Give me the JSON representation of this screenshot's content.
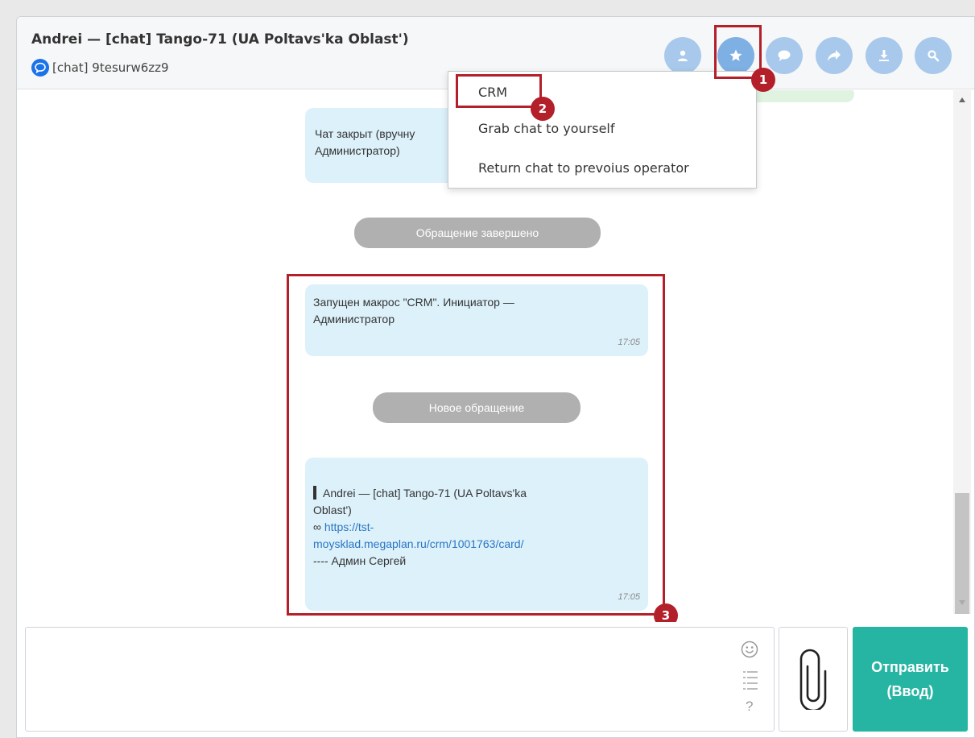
{
  "header": {
    "title": "Andrei — [chat] Tango-71 (UA Poltavs'ka Oblast')",
    "subtitle": "[chat] 9tesurw6zz9",
    "buttons": [
      "user-icon",
      "star-icon",
      "chat-icon",
      "forward-icon",
      "download-icon",
      "search-icon"
    ]
  },
  "dropdown": {
    "items": [
      "CRM",
      "Grab chat to yourself",
      "Return chat to prevoius operator"
    ]
  },
  "messages": {
    "closed_text_line1": "Чат закрыт (вручну",
    "closed_text_line2": "Администратор)",
    "pill_completed": "Обращение завершено",
    "macro_line1": "Запущен макрос \"CRM\". Инициатор —",
    "macro_line2": "Администратор",
    "macro_time": "17:05",
    "pill_new": "Новое обращение",
    "crm_line1": "Andrei — [chat] Tango-71 (UA Poltavs'ka",
    "crm_line2": "Oblast')",
    "crm_link_prefix": "∞",
    "crm_link_line1": "https://tst-",
    "crm_link_line2": "moysklad.megaplan.ru/crm/1001763/card/",
    "crm_sign": "---- Админ Сергей",
    "crm_time": "17:05"
  },
  "annotations": {
    "badge1": "1",
    "badge2": "2",
    "badge3": "3"
  },
  "composer": {
    "help": "?"
  },
  "send": {
    "line1": "Отправить",
    "line2": "(Ввод)"
  },
  "colors": {
    "accent": "#27b5a3",
    "highlight": "#b4202a",
    "bubble": "#ddf1fa",
    "header_btn": "#a8c9ec"
  }
}
